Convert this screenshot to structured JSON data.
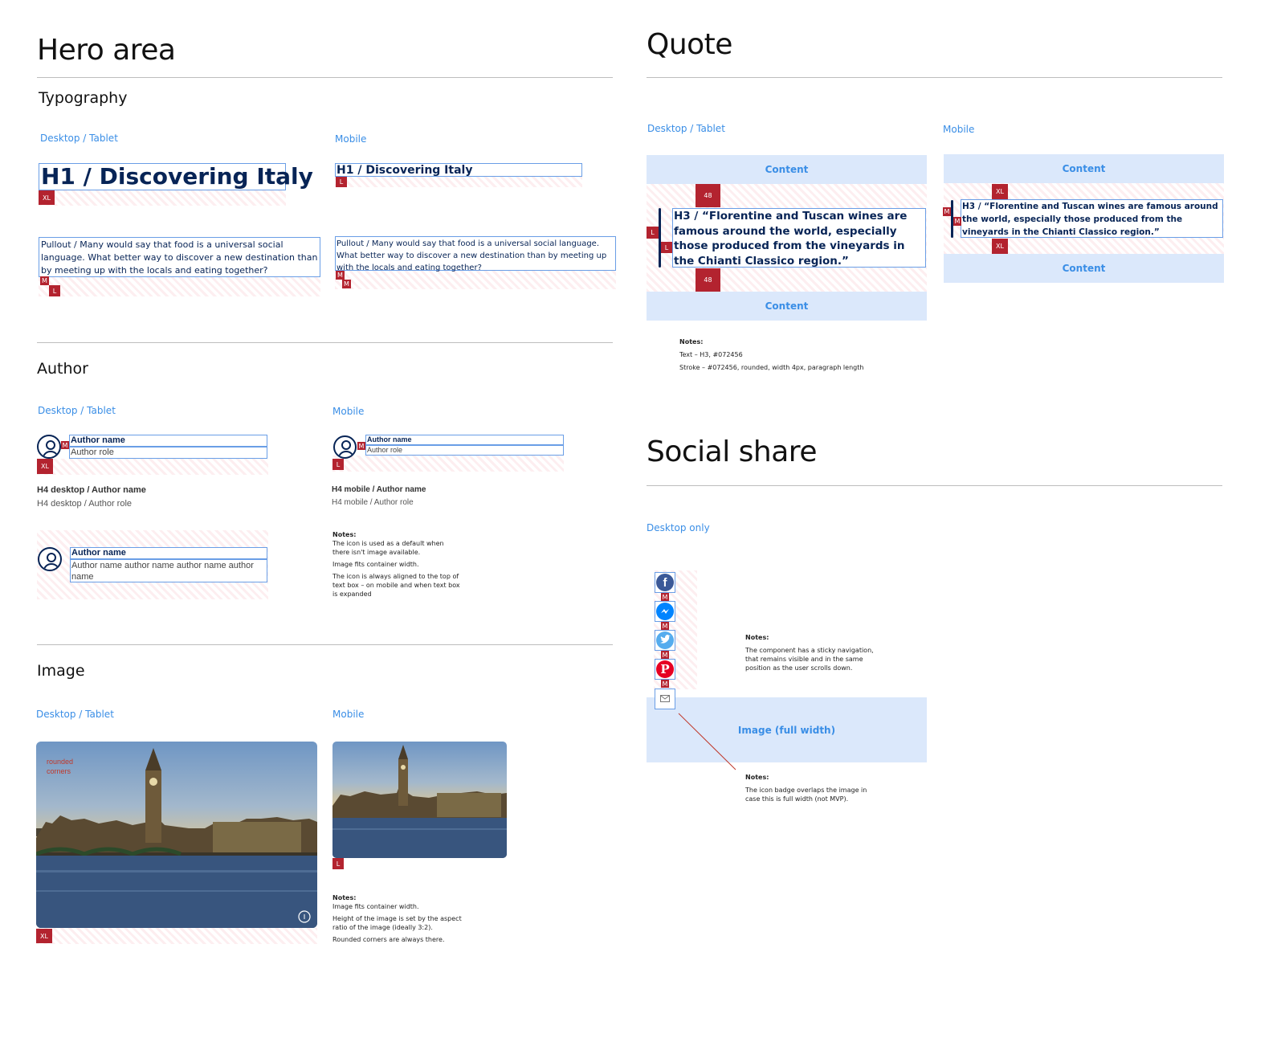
{
  "hero": {
    "title": "Hero area",
    "typography": "Typography",
    "desktop_label": "Desktop / Tablet",
    "mobile_label": "Mobile",
    "h1_desktop": "H1 / Discovering Italy",
    "h1_mobile": "H1 / Discovering Italy",
    "pullout_desktop": "Pullout / Many would say that food is a universal social language. What better way to discover a new destination than by meeting up with the locals and eating together?",
    "pullout_mobile": "Pullout / Many would say that food is a universal social language. What better way to discover a new destination than by meeting up with the locals and eating together?",
    "badges": {
      "xl": "XL",
      "l": "L",
      "m": "M"
    }
  },
  "author": {
    "title": "Author",
    "desktop_label": "Desktop / Tablet",
    "mobile_label": "Mobile",
    "name": "Author name",
    "role": "Author role",
    "h4_desktop_name": "H4 desktop / Author name",
    "h4_desktop_role": "H4 desktop / Author role",
    "h4_mobile_name": "H4 mobile / Author name",
    "h4_mobile_role": "H4 mobile / Author role",
    "long_name": "Author name",
    "long_role": "Author name author name author name author name",
    "notes_title": "Notes:",
    "notes": [
      "The icon is used as a default when there isn't image available.",
      "Image fits container width.",
      "The icon is always aligned to the top of text box – on mobile and when text box is expanded"
    ]
  },
  "image": {
    "title": "Image",
    "desktop_label": "Desktop / Tablet",
    "mobile_label": "Mobile",
    "annotation": "rounded corners",
    "notes_title": "Notes:",
    "notes": [
      "Image fits container width.",
      "Height of the image is set by the aspect ratio of the image (ideally 3:2).",
      "Rounded corners are always there."
    ]
  },
  "quote": {
    "title": "Quote",
    "desktop_label": "Desktop / Tablet",
    "mobile_label": "Mobile",
    "content": "Content",
    "spacing": "48",
    "text": "H3 / “Florentine and Tuscan wines are famous around the world, especially those produced from the vineyards in the Chianti Classico region.”",
    "notes_title": "Notes:",
    "notes": [
      "Text – H3, #072456",
      "Stroke – #072456, rounded, width 4px, paragraph length"
    ]
  },
  "social": {
    "title": "Social share",
    "label": "Desktop only",
    "icons": [
      "facebook-icon",
      "messenger-icon",
      "twitter-icon",
      "pinterest-icon",
      "email-icon"
    ],
    "image_label": "Image (full width)",
    "notes1_title": "Notes:",
    "notes1": "The component has a sticky navigation, that remains visible and in the same position as the user scrolls down.",
    "notes2_title": "Notes:",
    "notes2": "The icon badge overlaps the image in case this is full width (not MVP)."
  },
  "colors": {
    "navy": "#072456",
    "accent_blue": "#3a8ee6",
    "badge_red": "#b3232f",
    "content_bg": "#dbe8fb"
  }
}
